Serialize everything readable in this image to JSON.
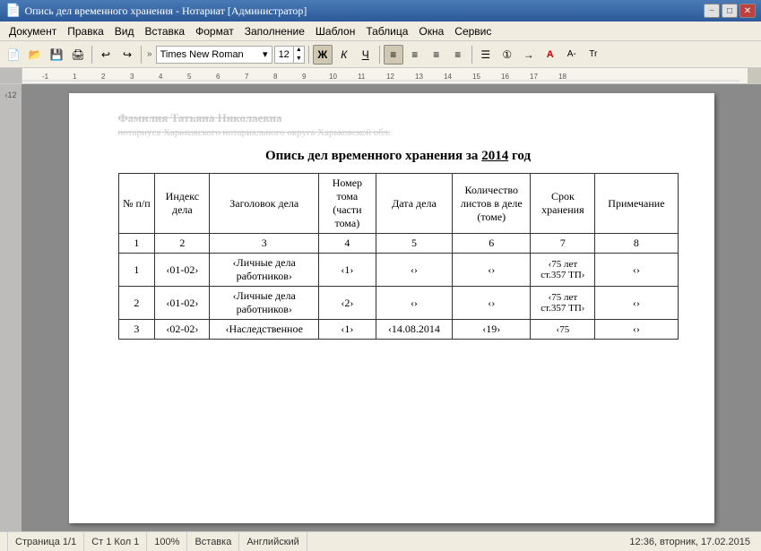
{
  "titleBar": {
    "title": "Опись дел временного хранения - Нотариат [Администратор]",
    "minBtn": "−",
    "maxBtn": "□",
    "closeBtn": "✕"
  },
  "menuBar": {
    "items": [
      "Документ",
      "Правка",
      "Вид",
      "Вставка",
      "Формат",
      "Заполнение",
      "Шаблон",
      "Таблица",
      "Окна",
      "Сервис"
    ]
  },
  "toolbar": {
    "fontName": "Times New Roman",
    "fontSize": "12",
    "bold": "Ж",
    "italic": "К",
    "underline": "Ч"
  },
  "document": {
    "blurredLine1": "Фамилия Татьяна Николаевна",
    "blurredLine2": "нотариуса Харьковского нотариального округа Харьковской обл.",
    "title": "Опись дел временного хранения за ",
    "titleYear": "2014",
    "titleEnd": " год",
    "tableHeaders": {
      "col1": "№ п/п",
      "col2": "Индекс дела",
      "col3": "Заголовок дела",
      "col4": "Номер тома (части тома)",
      "col5": "Дата дела",
      "col6": "Количество листов в деле (томе)",
      "col7": "Срок хранения",
      "col8": "Примечание"
    },
    "tableHeaderNums": {
      "n1": "1",
      "n2": "2",
      "n3": "3",
      "n4": "4",
      "n5": "5",
      "n6": "6",
      "n7": "7",
      "n8": "8"
    },
    "rows": [
      {
        "num": "1",
        "index": "‹01-02›",
        "title": "‹Личные дела работников›",
        "tome": "‹1›",
        "date": "‹›",
        "sheets": "‹›",
        "term": "‹75 лет ст.357 ТП›",
        "note": "‹›"
      },
      {
        "num": "2",
        "index": "‹01-02›",
        "title": "‹Личные дела работников›",
        "tome": "‹2›",
        "date": "‹›",
        "sheets": "‹›",
        "term": "‹75 лет ст.357 ТП›",
        "note": "‹›"
      },
      {
        "num": "3",
        "index": "‹02-02›",
        "title": "‹Наследственное",
        "tome": "‹1›",
        "date": "‹14.08.2014",
        "sheets": "‹19›",
        "term": "‹75",
        "note": "‹›"
      }
    ]
  },
  "statusBar": {
    "page": "Страница 1/1",
    "cursor": "Ст 1 Кол 1",
    "zoom": "100%",
    "mode": "Вставка",
    "lang": "Английский",
    "time": "12:36, вторник, 17.02.2015"
  }
}
